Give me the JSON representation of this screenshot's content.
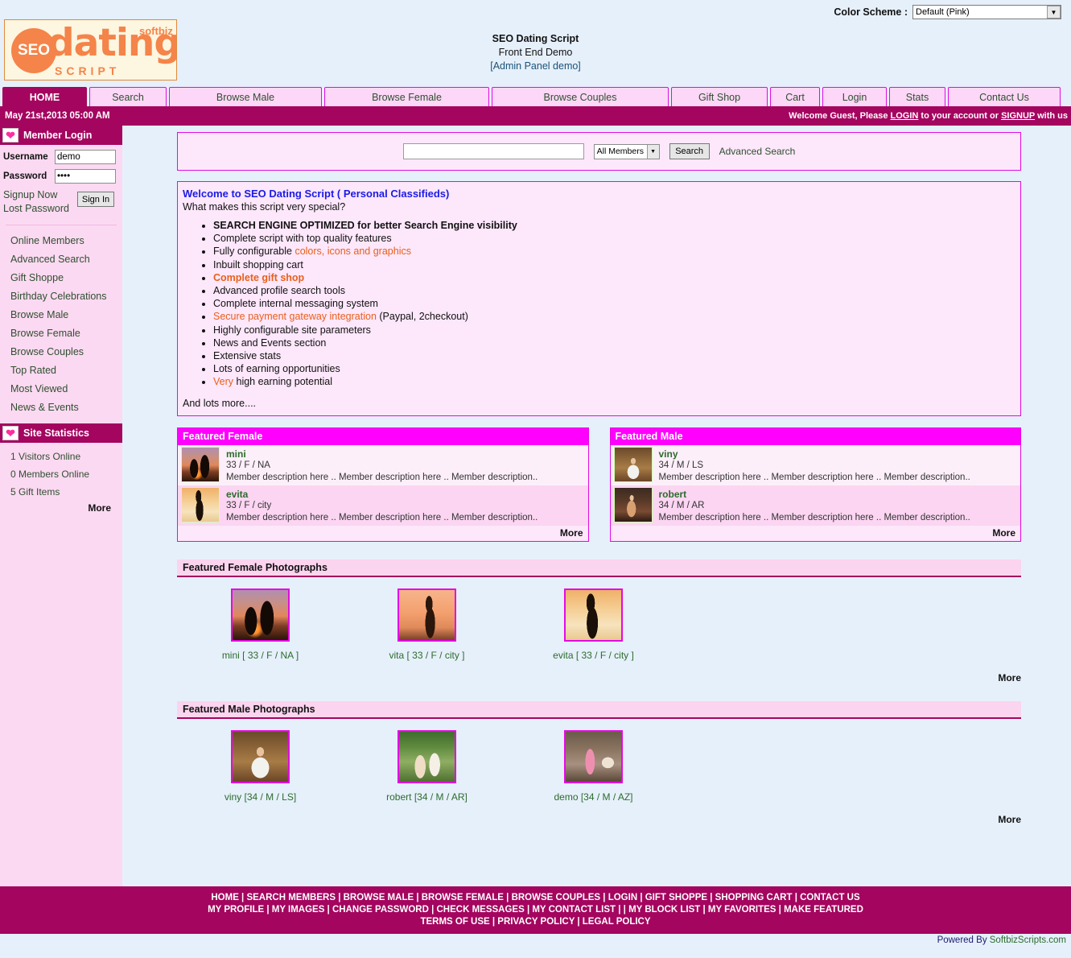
{
  "topbar": {
    "color_scheme_label": "Color Scheme :",
    "color_scheme_value": "Default (Pink)"
  },
  "logo": {
    "seo": "SEO",
    "dating": "dating",
    "softbiz": "softbiz",
    "script": "SCRIPT"
  },
  "site_title": {
    "line1": "SEO Dating Script",
    "line2": "Front End Demo",
    "line3": "[Admin Panel demo]"
  },
  "nav": {
    "tabs": [
      {
        "label": "HOME",
        "active": true
      },
      {
        "label": "Search",
        "active": false
      },
      {
        "label": "Browse Male",
        "active": false
      },
      {
        "label": "Browse Female",
        "active": false
      },
      {
        "label": "Browse Couples",
        "active": false
      },
      {
        "label": "Gift Shop",
        "active": false
      },
      {
        "label": "Cart",
        "active": false
      },
      {
        "label": "Login",
        "active": false
      },
      {
        "label": "Stats",
        "active": false
      },
      {
        "label": "Contact Us",
        "active": false
      }
    ]
  },
  "statusbar": {
    "datetime": "May 21st,2013 05:00 AM",
    "welcome_pre": "Welcome Guest, Please ",
    "welcome_login": "LOGIN",
    "welcome_mid": " to your account or ",
    "welcome_signup": "SIGNUP",
    "welcome_post": " with us"
  },
  "sidebar": {
    "login_panel": {
      "title": "Member Login",
      "username_label": "Username",
      "username_value": "demo",
      "password_label": "Password",
      "password_value": "demo",
      "signup_link": "Signup Now",
      "lost_password_link": "Lost Password",
      "signin_button": "Sign In"
    },
    "nav_links": [
      "Online Members",
      "Advanced Search",
      "Gift Shoppe",
      "Birthday Celebrations",
      "Browse Male",
      "Browse Female",
      "Browse Couples",
      "Top Rated",
      "Most Viewed",
      "News & Events"
    ],
    "stats_panel": {
      "title": "Site Statistics",
      "items": [
        "1 Visitors Online",
        "0 Members Online",
        "5 Gift Items"
      ],
      "more": "More"
    }
  },
  "search": {
    "query_value": "",
    "scope_value": "All Members",
    "button_label": "Search",
    "advanced_link": "Advanced Search"
  },
  "welcome_box": {
    "title": "Welcome to SEO Dating Script ( Personal Classifieds)",
    "subtitle": "What makes this script very special?",
    "features": [
      {
        "text": "SEARCH ENGINE OPTIMIZED for better Search Engine visibility",
        "style": "bold"
      },
      {
        "text": "Complete script with top quality features",
        "style": "plain"
      },
      {
        "text": "Fully configurable ",
        "accent": "colors, icons and graphics",
        "style": "split"
      },
      {
        "text": "Inbuilt shopping cart",
        "style": "plain"
      },
      {
        "text": "Complete gift shop",
        "style": "accent-bold"
      },
      {
        "text": "Advanced profile search tools",
        "style": "plain"
      },
      {
        "text": "Complete internal messaging system",
        "style": "plain"
      },
      {
        "accent": "Secure payment gateway integration",
        "text": " (Paypal, 2checkout)",
        "style": "accent-first"
      },
      {
        "text": "Highly configurable site parameters",
        "style": "plain"
      },
      {
        "text": "News and Events section",
        "style": "plain"
      },
      {
        "text": "Extensive stats",
        "style": "plain"
      },
      {
        "text": "Lots of earning opportunities",
        "style": "plain"
      },
      {
        "accent": "Very",
        "text": " high earning potential",
        "style": "accent-first"
      }
    ],
    "footer_text": "And lots more...."
  },
  "featured_female": {
    "title": "Featured Female",
    "more": "More",
    "members": [
      {
        "name": "mini",
        "meta": "33 / F / NA",
        "description": "Member description here .. Member description here .. Member description..",
        "art": "art-couple-sunset"
      },
      {
        "name": "evita",
        "meta": "33 / F / city",
        "description": "Member description here .. Member description here .. Member description..",
        "art": "art-sil-tall"
      }
    ]
  },
  "featured_male": {
    "title": "Featured Male",
    "more": "More",
    "members": [
      {
        "name": "viny",
        "meta": "34 / M / LS",
        "description": "Member description here .. Member description here .. Member description..",
        "art": "art-barista"
      },
      {
        "name": "robert",
        "meta": "34 / M / AR",
        "description": "Member description here .. Member description here .. Member description..",
        "art": "art-violin"
      }
    ]
  },
  "female_photos": {
    "title": "Featured Female Photographs",
    "more": "More",
    "items": [
      {
        "caption": "mini [ 33 / F / NA ]",
        "art": "art-couple-sunset"
      },
      {
        "caption": "vita [ 33 / F / city ]",
        "art": "art-field-sunset"
      },
      {
        "caption": "evita [ 33 / F / city ]",
        "art": "art-sil-tall"
      }
    ]
  },
  "male_photos": {
    "title": "Featured Male Photographs",
    "more": "More",
    "items": [
      {
        "caption": "viny [34 / M / LS]",
        "art": "art-barista"
      },
      {
        "caption": "robert [34 / M / AR]",
        "art": "art-couple-garden"
      },
      {
        "caption": "demo [34 / M / AZ]",
        "art": "art-shopper"
      }
    ]
  },
  "footer": {
    "line1": "HOME | SEARCH MEMBERS | BROWSE MALE | BROWSE FEMALE | BROWSE COUPLES | LOGIN | GIFT SHOPPE | SHOPPING CART | CONTACT US",
    "line2": "MY PROFILE | MY IMAGES | CHANGE PASSWORD | CHECK MESSAGES | MY CONTACT LIST | | MY BLOCK LIST | MY FAVORITES | MAKE FEATURED",
    "line3": "TERMS OF USE | PRIVACY POLICY | LEGAL POLICY",
    "powered_prefix": "Powered By ",
    "powered_name": "SoftbizScripts.com"
  },
  "colors": {
    "maroon": "#a4055f",
    "magenta": "#ff00ff",
    "pink_bg": "#fcd9f2",
    "page_bg": "#e6f0fb",
    "orange": "#e8601c",
    "link_green": "#2f4f2f"
  }
}
